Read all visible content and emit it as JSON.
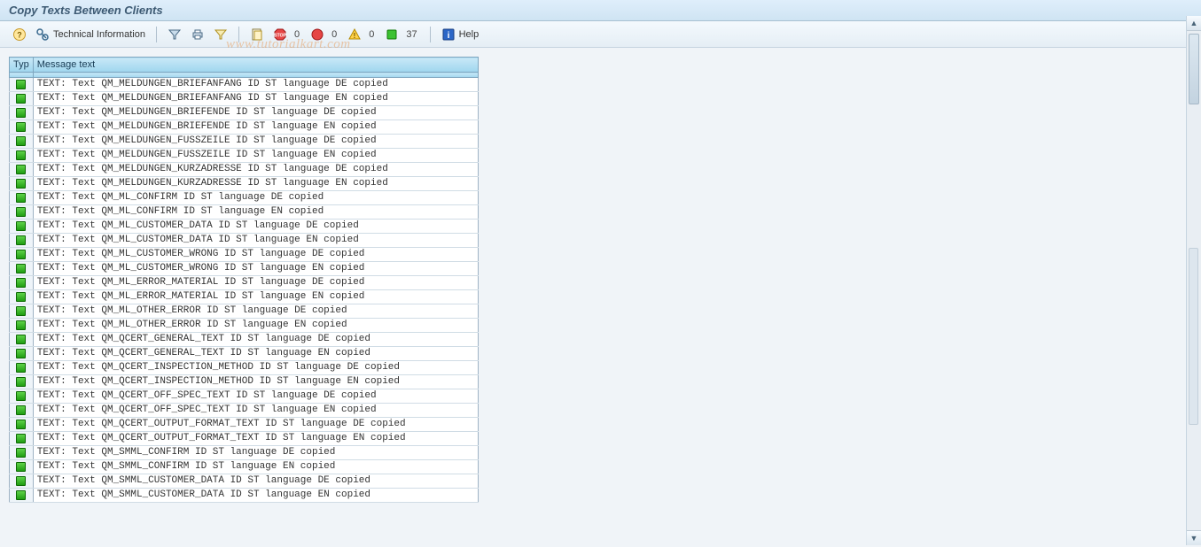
{
  "title": "Copy Texts Between Clients",
  "toolbar": {
    "technical_info": "Technical Information",
    "help": "Help",
    "stop_count": "0",
    "error_count": "0",
    "warn_count": "0",
    "ok_count": "37"
  },
  "table": {
    "headers": {
      "typ": "Typ",
      "msg": "Message text"
    }
  },
  "watermark": "www.tutorialkart.com",
  "messages": [
    "TEXT: Text QM_MELDUNGEN_BRIEFANFANG ID ST language DE copied",
    "TEXT: Text QM_MELDUNGEN_BRIEFANFANG ID ST language EN copied",
    "TEXT: Text QM_MELDUNGEN_BRIEFENDE ID ST language DE copied",
    "TEXT: Text QM_MELDUNGEN_BRIEFENDE ID ST language EN copied",
    "TEXT: Text QM_MELDUNGEN_FUSSZEILE ID ST language DE copied",
    "TEXT: Text QM_MELDUNGEN_FUSSZEILE ID ST language EN copied",
    "TEXT: Text QM_MELDUNGEN_KURZADRESSE ID ST language DE copied",
    "TEXT: Text QM_MELDUNGEN_KURZADRESSE ID ST language EN copied",
    "TEXT: Text QM_ML_CONFIRM ID ST language DE copied",
    "TEXT: Text QM_ML_CONFIRM ID ST language EN copied",
    "TEXT: Text QM_ML_CUSTOMER_DATA ID ST language DE copied",
    "TEXT: Text QM_ML_CUSTOMER_DATA ID ST language EN copied",
    "TEXT: Text QM_ML_CUSTOMER_WRONG ID ST language DE copied",
    "TEXT: Text QM_ML_CUSTOMER_WRONG ID ST language EN copied",
    "TEXT: Text QM_ML_ERROR_MATERIAL ID ST language DE copied",
    "TEXT: Text QM_ML_ERROR_MATERIAL ID ST language EN copied",
    "TEXT: Text QM_ML_OTHER_ERROR ID ST language DE copied",
    "TEXT: Text QM_ML_OTHER_ERROR ID ST language EN copied",
    "TEXT: Text QM_QCERT_GENERAL_TEXT ID ST language DE copied",
    "TEXT: Text QM_QCERT_GENERAL_TEXT ID ST language EN copied",
    "TEXT: Text QM_QCERT_INSPECTION_METHOD ID ST language DE copied",
    "TEXT: Text QM_QCERT_INSPECTION_METHOD ID ST language EN copied",
    "TEXT: Text QM_QCERT_OFF_SPEC_TEXT ID ST language DE copied",
    "TEXT: Text QM_QCERT_OFF_SPEC_TEXT ID ST language EN copied",
    "TEXT: Text QM_QCERT_OUTPUT_FORMAT_TEXT ID ST language DE copied",
    "TEXT: Text QM_QCERT_OUTPUT_FORMAT_TEXT ID ST language EN copied",
    "TEXT: Text QM_SMML_CONFIRM ID ST language DE copied",
    "TEXT: Text QM_SMML_CONFIRM ID ST language EN copied",
    "TEXT: Text QM_SMML_CUSTOMER_DATA ID ST language DE copied",
    "TEXT: Text QM_SMML_CUSTOMER_DATA ID ST language EN copied"
  ]
}
